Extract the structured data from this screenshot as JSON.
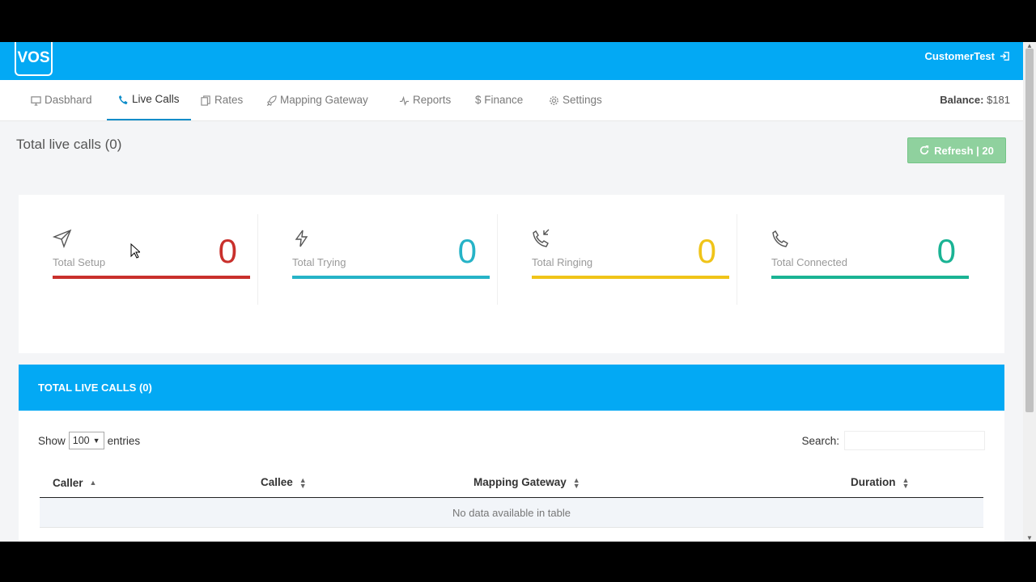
{
  "header": {
    "logo": "VOS",
    "user": "CustomerTest"
  },
  "nav": {
    "items": [
      {
        "label": "Dasbhard",
        "icon": "monitor-icon"
      },
      {
        "label": "Live Calls",
        "icon": "phone-icon",
        "active": true
      },
      {
        "label": "Rates",
        "icon": "copy-icon"
      },
      {
        "label": "Mapping Gateway",
        "icon": "rocket-icon"
      },
      {
        "label": "Reports",
        "icon": "pulse-icon"
      },
      {
        "label": "$ Finance",
        "icon": "dollar-icon"
      },
      {
        "label": "Settings",
        "icon": "gear-icon"
      }
    ],
    "balance_label": "Balance:",
    "balance_value": "$181"
  },
  "page": {
    "title": "Total live calls (0)",
    "refresh_label": "Refresh | 20"
  },
  "stats": [
    {
      "label": "Total Setup",
      "value": "0",
      "color": "#c9302c",
      "icon": "send-icon"
    },
    {
      "label": "Total Trying",
      "value": "0",
      "color": "#26b3c7",
      "icon": "bolt-icon"
    },
    {
      "label": "Total Ringing",
      "value": "0",
      "color": "#f0c419",
      "icon": "phone-ringing-icon"
    },
    {
      "label": "Total Connected",
      "value": "0",
      "color": "#1ab394",
      "icon": "phone-icon"
    }
  ],
  "panel": {
    "title": "TOTAL LIVE CALLS (0)",
    "show_label": "Show",
    "entries_value": "100",
    "entries_label": "entries",
    "search_label": "Search:",
    "columns": [
      "Caller",
      "Callee",
      "Mapping Gateway",
      "Duration"
    ],
    "empty_text": "No data available in table"
  }
}
